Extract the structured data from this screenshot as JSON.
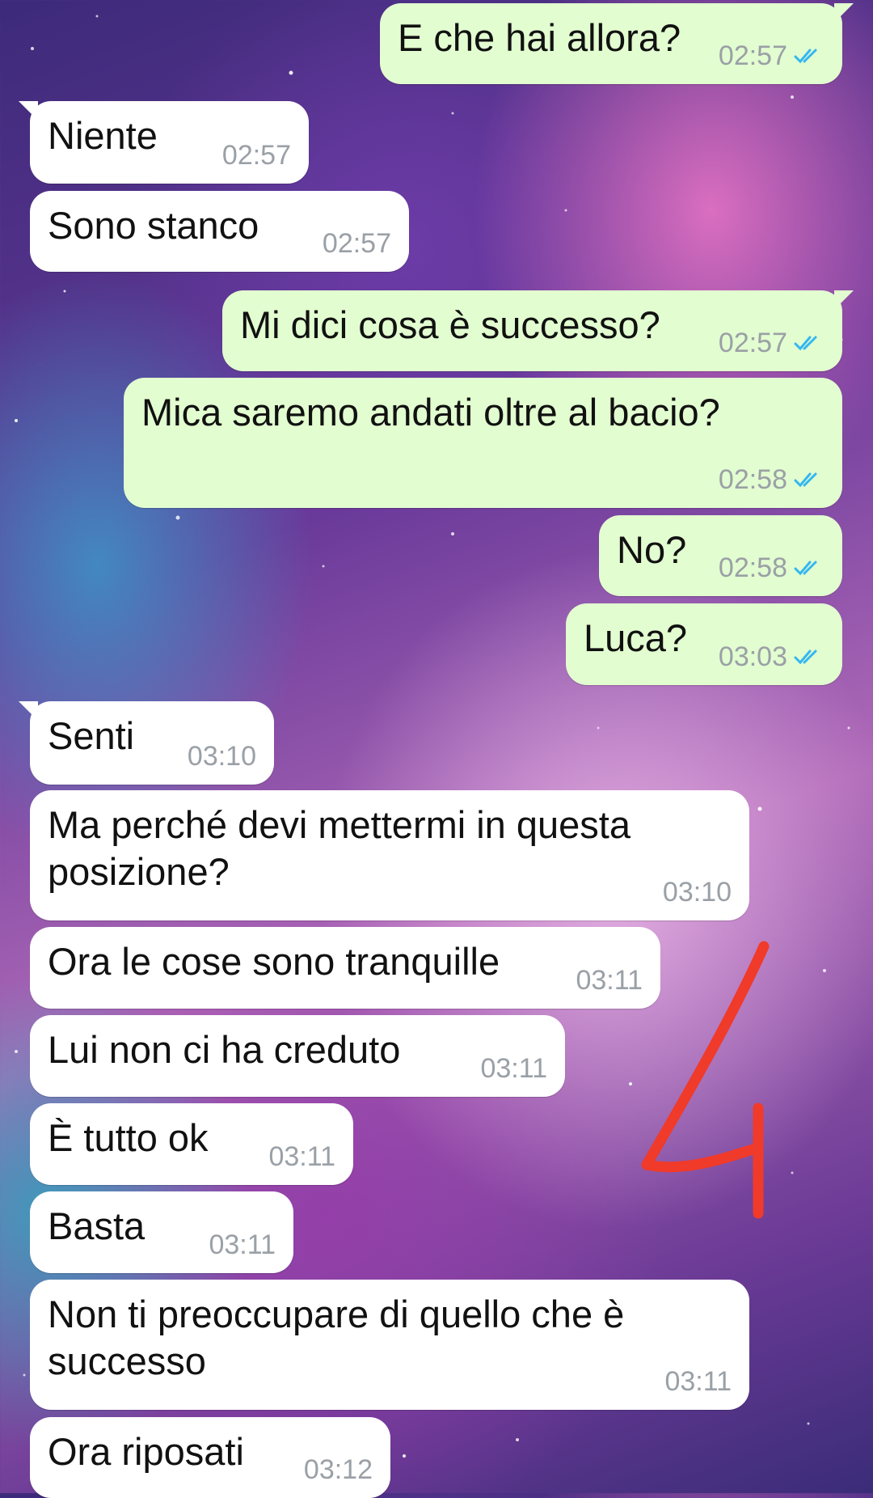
{
  "chat": {
    "messages": [
      {
        "dir": "out",
        "text": "E che hai allora?",
        "time": "02:57",
        "ticks": "read"
      },
      {
        "dir": "in",
        "text": "Niente",
        "time": "02:57"
      },
      {
        "dir": "in",
        "text": "Sono stanco",
        "time": "02:57"
      },
      {
        "dir": "out",
        "text": "Mi dici cosa è successo?",
        "time": "02:57",
        "ticks": "read"
      },
      {
        "dir": "out",
        "text": "Mica saremo andati oltre al bacio?",
        "time": "02:58",
        "ticks": "read"
      },
      {
        "dir": "out",
        "text": "No?",
        "time": "02:58",
        "ticks": "read"
      },
      {
        "dir": "out",
        "text": "Luca?",
        "time": "03:03",
        "ticks": "read"
      },
      {
        "dir": "in",
        "text": "Senti",
        "time": "03:10"
      },
      {
        "dir": "in",
        "text": "Ma perché devi mettermi in questa\nposizione?",
        "time": "03:10"
      },
      {
        "dir": "in",
        "text": "Ora le cose sono tranquille",
        "time": "03:11"
      },
      {
        "dir": "in",
        "text": "Lui non ci ha creduto",
        "time": "03:11"
      },
      {
        "dir": "in",
        "text": "È tutto ok",
        "time": "03:11"
      },
      {
        "dir": "in",
        "text": "Basta",
        "time": "03:11"
      },
      {
        "dir": "in",
        "text": "Non ti preoccupare di quello che è\nsuccesso",
        "time": "03:11"
      },
      {
        "dir": "in",
        "text": "Ora riposati",
        "time": "03:12"
      }
    ]
  },
  "annotation": {
    "text": "4",
    "color": "#f03a2a"
  },
  "colors": {
    "incoming": "#ffffff",
    "outgoing": "#e2fdd0",
    "read_tick": "#34b7f1",
    "timestamp": "#9aa0a6"
  },
  "icons": {
    "read_receipt": "double-check-icon"
  }
}
